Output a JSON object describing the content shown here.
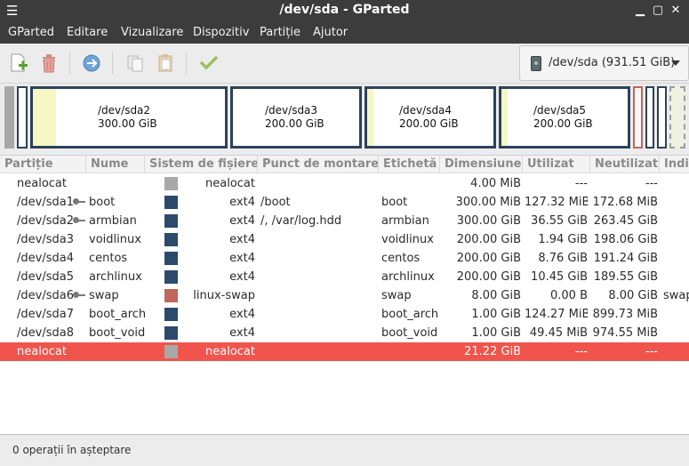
{
  "window": {
    "title": "/dev/sda - GParted"
  },
  "menu": [
    "GParted",
    "Editare",
    "Vizualizare",
    "Dispozitiv",
    "Partiție",
    "Ajutor"
  ],
  "toolbar": {
    "device_label": "/dev/sda (931.51 GiB)"
  },
  "diskmap": [
    {
      "name": "/dev/sda2",
      "size": "300.00 GiB",
      "used_fraction": 0.12
    },
    {
      "name": "/dev/sda3",
      "size": "200.00 GiB",
      "used_fraction": 0.01
    },
    {
      "name": "/dev/sda4",
      "size": "200.00 GiB",
      "used_fraction": 0.05
    },
    {
      "name": "/dev/sda5",
      "size": "200.00 GiB",
      "used_fraction": 0.05
    }
  ],
  "columns": [
    "Partiție",
    "Nume",
    "Sistem de fișiere",
    "Punct de montare",
    "Etichetă",
    "Dimensiune",
    "Utilizat",
    "Neutilizat",
    "Indi"
  ],
  "rows": [
    {
      "partition": "nealocat",
      "name": "",
      "fs": "nealocat",
      "fs_color": "#a8a8a8",
      "mount": "",
      "label": "",
      "size": "4.00 MiB",
      "used": "---",
      "unused": "---",
      "flags": "",
      "key": false
    },
    {
      "partition": "/dev/sda1",
      "name": "boot",
      "fs": "ext4",
      "fs_color": "#2c4a6c",
      "mount": "/boot",
      "label": "boot",
      "size": "300.00 MiB",
      "used": "127.32 MiB",
      "unused": "172.68 MiB",
      "flags": "",
      "key": true
    },
    {
      "partition": "/dev/sda2",
      "name": "armbian",
      "fs": "ext4",
      "fs_color": "#2c4a6c",
      "mount": "/, /var/log.hdd",
      "label": "armbian",
      "size": "300.00 GiB",
      "used": "36.55 GiB",
      "unused": "263.45 GiB",
      "flags": "",
      "key": true
    },
    {
      "partition": "/dev/sda3",
      "name": "voidlinux",
      "fs": "ext4",
      "fs_color": "#2c4a6c",
      "mount": "",
      "label": "voidlinux",
      "size": "200.00 GiB",
      "used": "1.94 GiB",
      "unused": "198.06 GiB",
      "flags": "",
      "key": false
    },
    {
      "partition": "/dev/sda4",
      "name": "centos",
      "fs": "ext4",
      "fs_color": "#2c4a6c",
      "mount": "",
      "label": "centos",
      "size": "200.00 GiB",
      "used": "8.76 GiB",
      "unused": "191.24 GiB",
      "flags": "",
      "key": false
    },
    {
      "partition": "/dev/sda5",
      "name": "archlinux",
      "fs": "ext4",
      "fs_color": "#2c4a6c",
      "mount": "",
      "label": "archlinux",
      "size": "200.00 GiB",
      "used": "10.45 GiB",
      "unused": "189.55 GiB",
      "flags": "",
      "key": false
    },
    {
      "partition": "/dev/sda6",
      "name": "swap",
      "fs": "linux-swap",
      "fs_color": "#c1665a",
      "mount": "",
      "label": "swap",
      "size": "8.00 GiB",
      "used": "0.00 B",
      "unused": "8.00 GiB",
      "flags": "swap",
      "key": true
    },
    {
      "partition": "/dev/sda7",
      "name": "boot_arch",
      "fs": "ext4",
      "fs_color": "#2c4a6c",
      "mount": "",
      "label": "boot_arch",
      "size": "1.00 GiB",
      "used": "124.27 MiB",
      "unused": "899.73 MiB",
      "flags": "",
      "key": false
    },
    {
      "partition": "/dev/sda8",
      "name": "boot_void",
      "fs": "ext4",
      "fs_color": "#2c4a6c",
      "mount": "",
      "label": "boot_void",
      "size": "1.00 GiB",
      "used": "49.45 MiB",
      "unused": "974.55 MiB",
      "flags": "",
      "key": false
    },
    {
      "partition": "nealocat",
      "name": "",
      "fs": "nealocat",
      "fs_color": "#a8a8a8",
      "mount": "",
      "label": "",
      "size": "21.22 GiB",
      "used": "---",
      "unused": "---",
      "flags": "",
      "key": false,
      "selected": true
    }
  ],
  "status": {
    "text": "0 operații în așteptare"
  },
  "colors": {
    "accent_selected": "#f0544c",
    "ext4": "#2c4a6c",
    "swap": "#c1665a",
    "unallocated": "#a8a8a8"
  }
}
